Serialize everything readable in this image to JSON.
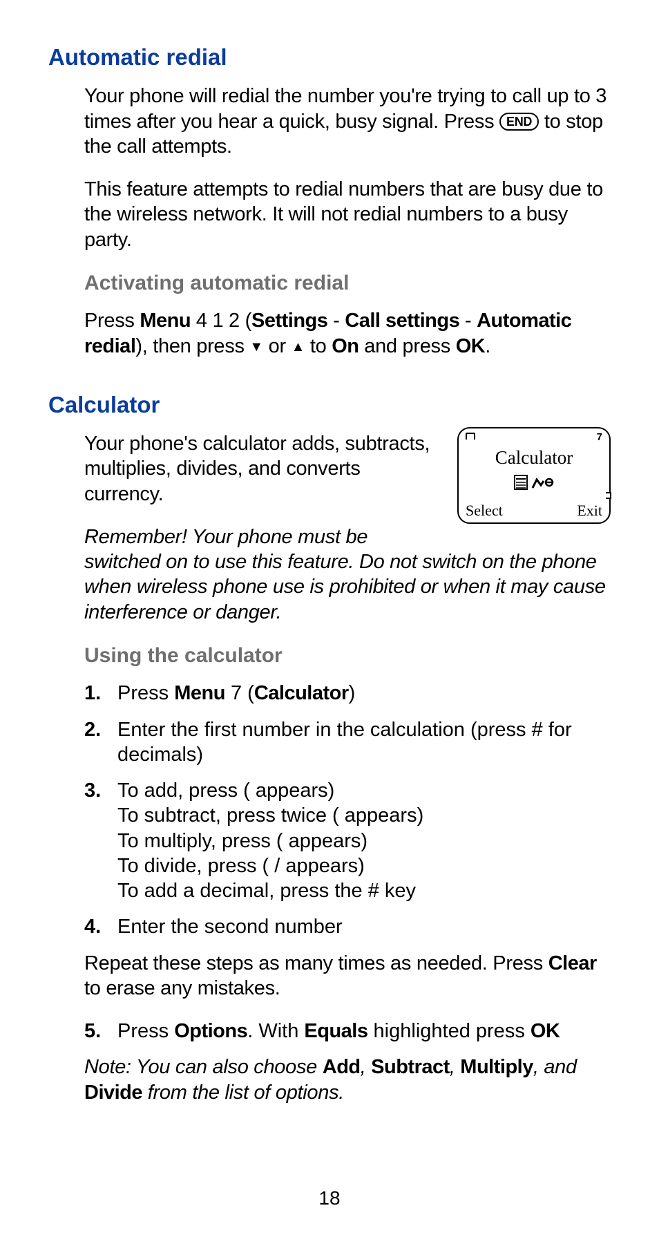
{
  "section1": {
    "heading": "Automatic redial",
    "p1_a": "Your phone will redial the number you're trying to call up to 3 times after you hear a quick, busy signal. Press ",
    "p1_key": "END",
    "p1_b": " to stop the call attempts.",
    "p2": "This feature attempts to redial numbers that are busy due to the wireless network. It will not redial numbers to a busy party.",
    "sub1": {
      "heading": "Activating automatic redial",
      "a": "Press ",
      "b": "Menu",
      "c": " 4 1 2 (",
      "d": "Settings",
      "e": " - ",
      "f": "Call settings",
      "g": " - ",
      "h": "Automatic redial",
      "i": "), then press ",
      "down": "▼",
      "j": " or ",
      "up": "▲",
      "k": " to ",
      "on": "On",
      "l": " and press ",
      "ok": "OK",
      "m": "."
    }
  },
  "section2": {
    "heading": "Calculator",
    "p1": "Your phone's calculator adds, subtracts, multiplies, divides, and converts currency.",
    "screen": {
      "title": "Calculator",
      "ind7": "7",
      "select": "Select",
      "exit": "Exit"
    },
    "note1": "Remember! Your phone must be switched on to use this feature. Do not switch on the phone when wireless phone use is prohibited or when it may cause interference or danger.",
    "sub1": {
      "heading": "Using the calculator"
    },
    "steps": {
      "s1": {
        "n": "1.",
        "a": "Press ",
        "b": "Menu",
        "c": " 7 (",
        "d": "Calculator",
        "e": ")"
      },
      "s2": {
        "n": "2.",
        "t": "Enter the first number in the calculation (press # for decimals)"
      },
      "s3": {
        "n": "3.",
        "l1": "To add, press     (   appears)",
        "l2": "To subtract, press       twice (   appears)",
        "l3": "To multiply, press        (   appears)",
        "l4": "To divide, press          ( /  appears)",
        "l5": "To add a decimal, press the # key"
      },
      "s4": {
        "n": "4.",
        "t": "Enter the second number"
      }
    },
    "repeat_a": "Repeat these steps as many times as needed. Press ",
    "repeat_b": "Clear",
    "repeat_c": " to erase any mistakes.",
    "s5": {
      "n": "5.",
      "a": "Press ",
      "b": "Options",
      "c": ". With ",
      "d": "Equals",
      "e": " highlighted  press ",
      "f": "OK"
    },
    "note2": {
      "a": "Note: You can also choose ",
      "b": "Add",
      "c": ", ",
      "d": "Subtract",
      "e": ", ",
      "f": "Multiply",
      "g": ", and ",
      "h": "Divide",
      "i": " from the list of options."
    }
  },
  "pagenum": "18"
}
